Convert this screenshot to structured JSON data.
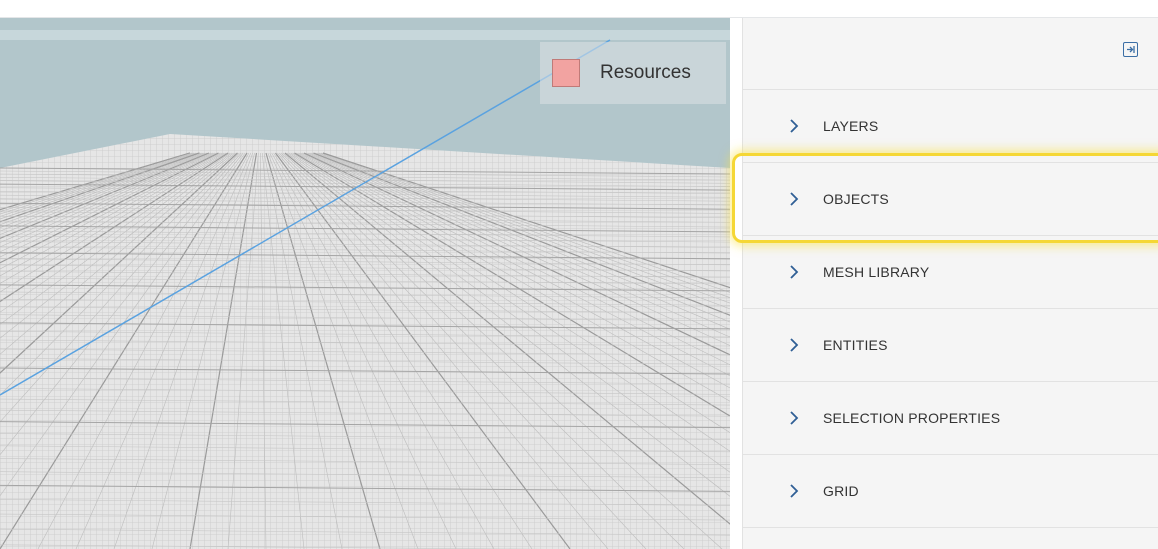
{
  "viewport": {
    "legend": {
      "label": "Resources",
      "swatch_color": "#f2a3a1"
    },
    "sky_color": "#b2c6cb",
    "ground_color": "#e4e4e4",
    "axis_line_color": "#5aa2e0"
  },
  "panel": {
    "collapse_icon": "collapse-panel-icon",
    "sections": [
      {
        "label": "LAYERS"
      },
      {
        "label": "OBJECTS",
        "highlighted": true
      },
      {
        "label": "MESH LIBRARY"
      },
      {
        "label": "ENTITIES"
      },
      {
        "label": "SELECTION PROPERTIES"
      },
      {
        "label": "GRID"
      }
    ]
  },
  "colors": {
    "accent": "#3b6ea5",
    "highlight": "#f5d735"
  }
}
